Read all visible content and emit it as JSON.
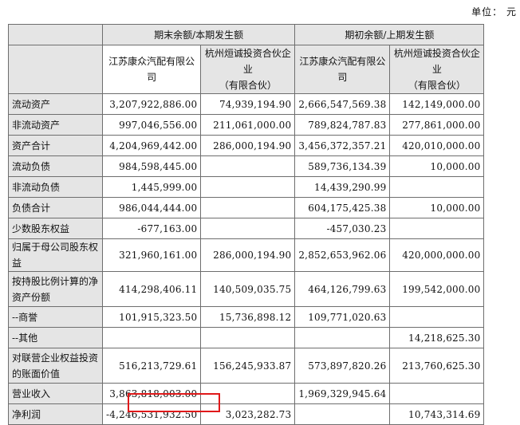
{
  "unit_label": "单位：  元",
  "header": {
    "group_current": "期末余额/本期发生额",
    "group_prior": "期初余额/上期发生额",
    "company_a": "江苏康众汽配有限公司",
    "company_b_line1": "杭州烜诚投资合伙企业",
    "company_b_line2": "（有限合伙）"
  },
  "rows": [
    {
      "label": "流动资产",
      "a_cur": "3,207,922,886.00",
      "b_cur": "74,939,194.90",
      "a_prev": "2,666,547,569.38",
      "b_prev": "142,149,000.00"
    },
    {
      "label": "非流动资产",
      "a_cur": "997,046,556.00",
      "b_cur": "211,061,000.00",
      "a_prev": "789,824,787.83",
      "b_prev": "277,861,000.00"
    },
    {
      "label": "资产合计",
      "a_cur": "4,204,969,442.00",
      "b_cur": "286,000,194.90",
      "a_prev": "3,456,372,357.21",
      "b_prev": "420,010,000.00"
    },
    {
      "label": "流动负债",
      "a_cur": "984,598,445.00",
      "b_cur": "",
      "a_prev": "589,736,134.39",
      "b_prev": "10,000.00"
    },
    {
      "label": "非流动负债",
      "a_cur": "1,445,999.00",
      "b_cur": "",
      "a_prev": "14,439,290.99",
      "b_prev": ""
    },
    {
      "label": "负债合计",
      "a_cur": "986,044,444.00",
      "b_cur": "",
      "a_prev": "604,175,425.38",
      "b_prev": "10,000.00"
    },
    {
      "label": "少数股东权益",
      "a_cur": "-677,163.00",
      "b_cur": "",
      "a_prev": "-457,030.23",
      "b_prev": ""
    },
    {
      "label": "归属于母公司股东权益",
      "a_cur": "321,960,161.00",
      "b_cur": "286,000,194.90",
      "a_prev": "2,852,653,962.06",
      "b_prev": "420,000,000.00"
    },
    {
      "label": "按持股比例计算的净资产份额",
      "a_cur": "414,298,406.11",
      "b_cur": "140,509,035.75",
      "a_prev": "464,126,799.63",
      "b_prev": "199,542,000.00"
    },
    {
      "label": "--商誉",
      "a_cur": "101,915,323.50",
      "b_cur": "15,736,898.12",
      "a_prev": "109,771,020.63",
      "b_prev": ""
    },
    {
      "label": "--其他",
      "a_cur": "",
      "b_cur": "",
      "a_prev": "",
      "b_prev": "14,218,625.30"
    },
    {
      "label": "对联营企业权益投资的账面价值",
      "a_cur": "516,213,729.61",
      "b_cur": "156,245,933.87",
      "a_prev": "573,897,820.26",
      "b_prev": "213,760,625.30"
    },
    {
      "label": "营业收入",
      "a_cur": "3,863,818,003.00",
      "b_cur": "",
      "a_prev": "1,969,329,945.64",
      "b_prev": ""
    },
    {
      "label": "净利润",
      "a_cur": "-4,246,531,932.50",
      "b_cur": "3,023,282.73",
      "a_prev": "",
      "b_prev": "10,743,314.69"
    }
  ]
}
